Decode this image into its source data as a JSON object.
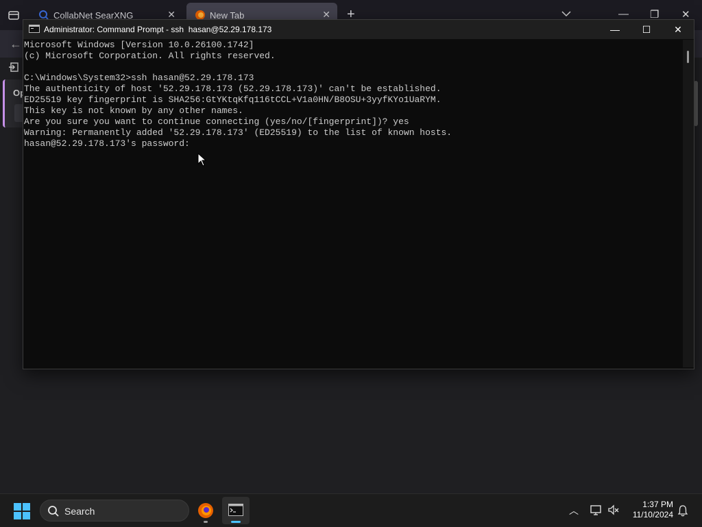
{
  "browser": {
    "tabs": [
      {
        "label": "CollabNet SearXNG",
        "close": "✕",
        "active": false
      },
      {
        "label": "New Tab",
        "close": "✕",
        "active": true
      }
    ],
    "new_tab": "+",
    "side_card_text": "Op"
  },
  "cmd": {
    "title": "Administrator: Command Prompt - ssh  hasan@52.29.178.173",
    "controls": {
      "minimize": "—",
      "maximize": "☐",
      "close": "✕"
    },
    "lines": [
      "Microsoft Windows [Version 10.0.26100.1742]",
      "(c) Microsoft Corporation. All rights reserved.",
      "",
      "C:\\Windows\\System32>ssh hasan@52.29.178.173",
      "The authenticity of host '52.29.178.173 (52.29.178.173)' can't be established.",
      "ED25519 key fingerprint is SHA256:GtYKtqKfq116tCCL+V1a0HN/B8OSU+3yyfKYo1UaRYM.",
      "This key is not known by any other names.",
      "Are you sure you want to continue connecting (yes/no/[fingerprint])? yes",
      "Warning: Permanently added '52.29.178.173' (ED25519) to the list of known hosts.",
      "hasan@52.29.178.173's password:"
    ]
  },
  "taskbar": {
    "search_label": "Search",
    "clock_time": "1:37 PM",
    "clock_date": "11/10/2024"
  }
}
